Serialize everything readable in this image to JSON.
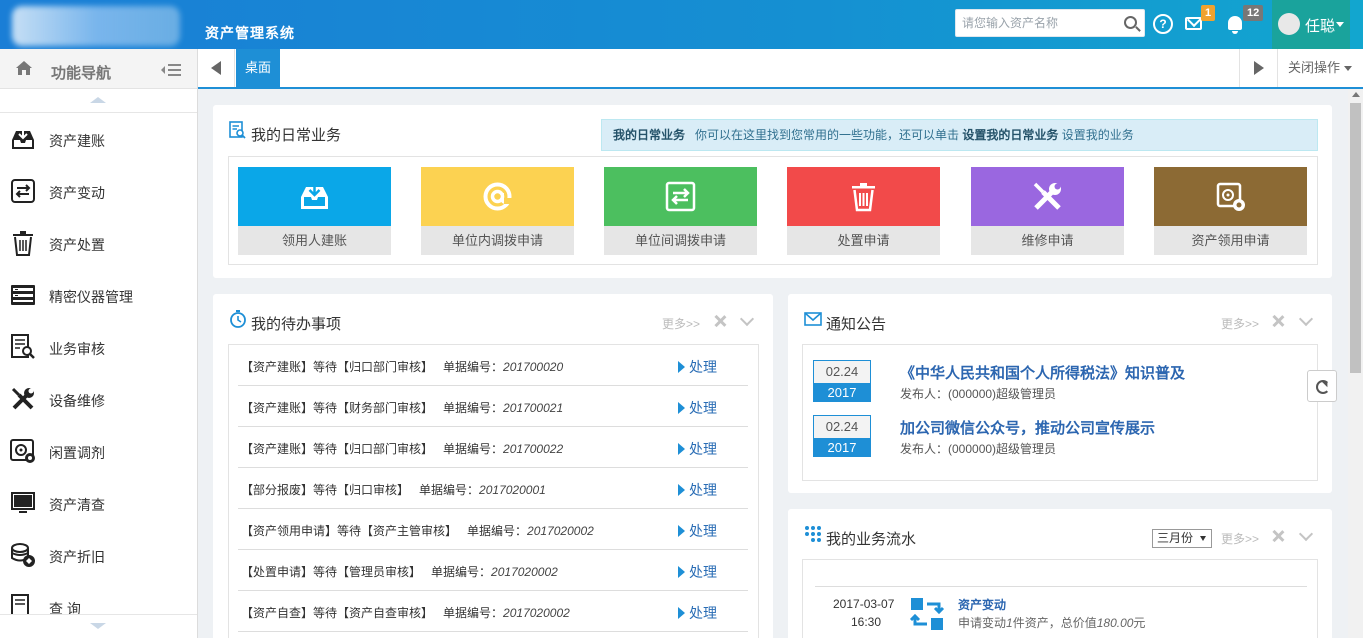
{
  "header": {
    "app_title": "资产管理系统",
    "search_placeholder": "请您输入资产名称",
    "mail_badge": "1",
    "notice_badge": "12",
    "user_name": "任聪"
  },
  "sidebar": {
    "title": "功能导航",
    "items": [
      {
        "label": "资产建账",
        "icon": "inbox-download-icon"
      },
      {
        "label": "资产变动",
        "icon": "swap-icon"
      },
      {
        "label": "资产处置",
        "icon": "trash-icon"
      },
      {
        "label": "精密仪器管理",
        "icon": "server-icon"
      },
      {
        "label": "业务审核",
        "icon": "review-icon"
      },
      {
        "label": "设备维修",
        "icon": "tools-icon"
      },
      {
        "label": "闲置调剂",
        "icon": "gear-box-icon"
      },
      {
        "label": "资产清查",
        "icon": "monitor-icon"
      },
      {
        "label": "资产折旧",
        "icon": "coins-icon"
      },
      {
        "label": "查 询",
        "icon": "query-icon"
      }
    ]
  },
  "tabs": {
    "active": "桌面",
    "close_ops": "关闭操作"
  },
  "daily": {
    "title": "我的日常业务",
    "tip_bold": "我的日常业务",
    "tip_text": "你可以在这里找到您常用的一些功能，还可以单击",
    "tip_link": "设置我的日常业务",
    "tip_tail": "设置我的业务",
    "tiles": [
      {
        "label": "领用人建账",
        "color": "#0aa7e8",
        "icon": "inbox-download-icon"
      },
      {
        "label": "单位内调拨申请",
        "color": "#fcd251",
        "icon": "at-icon"
      },
      {
        "label": "单位间调拨申请",
        "color": "#4cbf5f",
        "icon": "swap-icon"
      },
      {
        "label": "处置申请",
        "color": "#f24a4a",
        "icon": "trash-icon"
      },
      {
        "label": "维修申请",
        "color": "#9a67e0",
        "icon": "tools-icon"
      },
      {
        "label": "资产领用申请",
        "color": "#8c6a34",
        "icon": "safe-gear-icon"
      }
    ]
  },
  "todo": {
    "title": "我的待办事项",
    "more": "更多>>",
    "action": "处理",
    "no_label": "单据编号：",
    "rows": [
      {
        "text": "【资产建账】等待【归口部门审核】",
        "no": "201700020"
      },
      {
        "text": "【资产建账】等待【财务部门审核】",
        "no": "201700021"
      },
      {
        "text": "【资产建账】等待【归口部门审核】",
        "no": "201700022"
      },
      {
        "text": "【部分报废】等待【归口审核】",
        "no": "2017020001"
      },
      {
        "text": "【资产领用申请】等待【资产主管审核】",
        "no": "2017020002"
      },
      {
        "text": "【处置申请】等待【管理员审核】",
        "no": "2017020002"
      },
      {
        "text": "【资产自查】等待【资产自查审核】",
        "no": "2017020002"
      }
    ]
  },
  "notice": {
    "title": "通知公告",
    "more": "更多>>",
    "items": [
      {
        "day": "02.24",
        "year": "2017",
        "title": "《中华人民共和国个人所得税法》知识普及",
        "publisher": "发布人：(000000)超级管理员"
      },
      {
        "day": "02.24",
        "year": "2017",
        "title": "加公司微信公众号，推动公司宣传展示",
        "publisher": "发布人：(000000)超级管理员"
      }
    ]
  },
  "flow": {
    "title": "我的业务流水",
    "month": "三月份",
    "more": "更多>>",
    "item": {
      "date": "2017-03-07",
      "time": "16:30",
      "title": "资产变动",
      "desc_prefix": "申请变动",
      "count": "1",
      "desc_mid": "件资产，总价值",
      "amount": "180.00",
      "unit": "元"
    }
  }
}
